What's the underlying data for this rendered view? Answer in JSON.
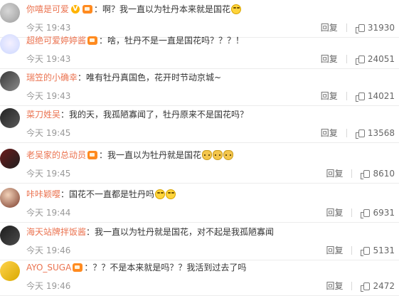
{
  "comments": [
    {
      "user": "你嘻是可爱",
      "badge_v": true,
      "content": "啊？我一直以为牡丹本来就是国花",
      "emojis": [
        "laugh"
      ],
      "time": "今天 19:43",
      "reply": "回复",
      "likes": "31930"
    },
    {
      "user": "超绝可爱婷婷酱",
      "badge_v": false,
      "content": "啥，牡丹不是一直是国花吗？？？！",
      "emojis": [],
      "time": "今天 19:43",
      "reply": "回复",
      "likes": "24051"
    },
    {
      "user": "瑞笠的小确幸",
      "badge_v": false,
      "content": "唯有牡丹真国色，花开时节动京城~",
      "emojis": [],
      "time": "今天 19:43",
      "reply": "回复",
      "likes": "14021"
    },
    {
      "user": "菜刀姓吴",
      "badge_v": false,
      "content": "我的天，我孤陋寡闻了，牡丹原来不是国花吗？",
      "emojis": [],
      "time": "今天 19:45",
      "reply": "回复",
      "likes": "13568"
    },
    {
      "user": "老吴家的总动员",
      "badge_v": false,
      "content": "我一直以为牡丹就是国花",
      "emojis": [
        "dog",
        "dog",
        "dog"
      ],
      "time": "今天 19:45",
      "reply": "回复",
      "likes": "8610"
    },
    {
      "user": "咔咔颖嘤",
      "badge_v": false,
      "content": "国花不一直都是牡丹吗",
      "emojis": [
        "laugh",
        "laugh"
      ],
      "time": "今天 19:44",
      "reply": "回复",
      "likes": "6931"
    },
    {
      "user": "海天站牌拌饭酱",
      "badge_v": false,
      "content": "我一直以为牡丹就是国花，对不起是我孤陋寡闻",
      "emojis": [],
      "time": "今天 19:46",
      "reply": "回复",
      "likes": "5131"
    },
    {
      "user": "AYO_SUGA",
      "badge_v": false,
      "content": "？？不是本来就是吗？？我活到过去了吗",
      "emojis": [],
      "time": "今天 19:46",
      "reply": "回复",
      "likes": "2472"
    }
  ]
}
